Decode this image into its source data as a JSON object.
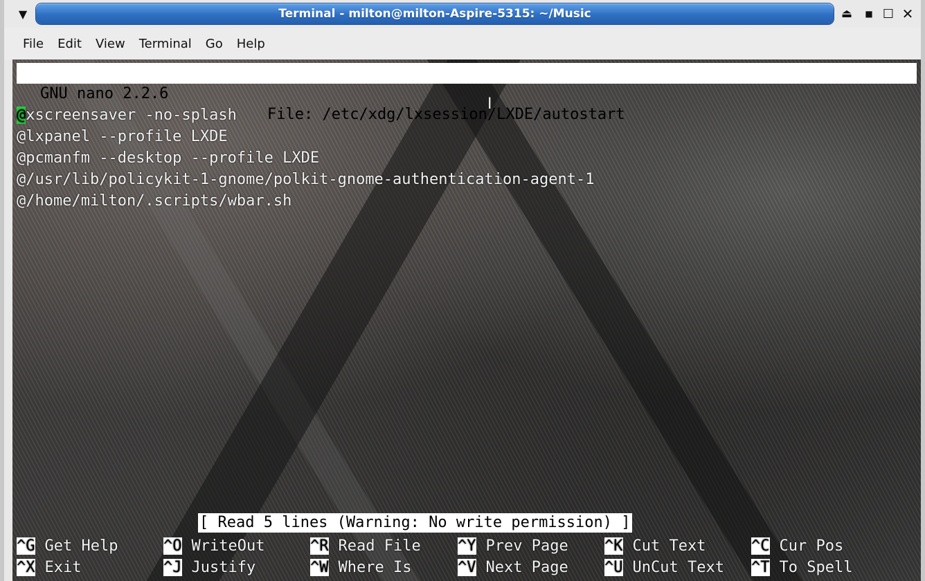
{
  "window": {
    "title": "Terminal - milton@milton-Aspire-5315: ~/Music",
    "menu_icon": "▼",
    "shade_icon": "⏏",
    "iconify_icon": "■",
    "maximize_icon": "☐",
    "close_icon": "✕"
  },
  "menubar": {
    "items": [
      "File",
      "Edit",
      "View",
      "Terminal",
      "Go",
      "Help"
    ]
  },
  "nano": {
    "version": "GNU nano 2.2.6",
    "file_label": "File: /etc/xdg/lxsession/LXDE/autostart",
    "lines": [
      {
        "first": "@",
        "rest": "xscreensaver -no-splash"
      },
      {
        "first": "",
        "rest": "@lxpanel --profile LXDE"
      },
      {
        "first": "",
        "rest": "@pcmanfm --desktop --profile LXDE"
      },
      {
        "first": "",
        "rest": "@/usr/lib/policykit-1-gnome/polkit-gnome-authentication-agent-1"
      },
      {
        "first": "",
        "rest": "@/home/milton/.scripts/wbar.sh"
      }
    ],
    "status_message": "[ Read 5 lines (Warning: No write permission) ]",
    "ibeam": "I",
    "shortcuts_row1": [
      {
        "key": "^G",
        "label": "Get Help"
      },
      {
        "key": "^O",
        "label": "WriteOut"
      },
      {
        "key": "^R",
        "label": "Read File"
      },
      {
        "key": "^Y",
        "label": "Prev Page"
      },
      {
        "key": "^K",
        "label": "Cut Text"
      },
      {
        "key": "^C",
        "label": "Cur Pos"
      }
    ],
    "shortcuts_row2": [
      {
        "key": "^X",
        "label": "Exit"
      },
      {
        "key": "^J",
        "label": "Justify"
      },
      {
        "key": "^W",
        "label": "Where Is"
      },
      {
        "key": "^V",
        "label": "Next Page"
      },
      {
        "key": "^U",
        "label": "UnCut Text"
      },
      {
        "key": "^T",
        "label": "To Spell"
      }
    ]
  },
  "colors": {
    "titlebar_accent": "#2f6fc2",
    "cursor": "#27c93f"
  }
}
